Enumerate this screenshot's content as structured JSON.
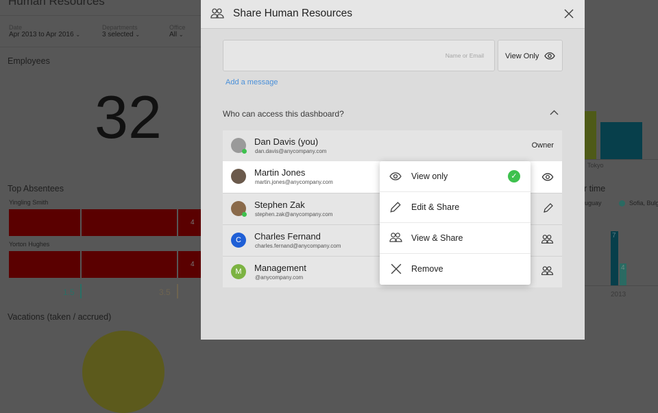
{
  "dashboard": {
    "title": "Human Resources",
    "filters": [
      {
        "label": "Date",
        "value": "Apr 2013 to Apr 2016"
      },
      {
        "label": "Departments",
        "value": "3 selected"
      },
      {
        "label": "Office",
        "value": "All"
      }
    ],
    "employees": {
      "title": "Employees",
      "value": "32"
    },
    "absentees": {
      "title": "Top Absentees",
      "rows": [
        {
          "name": "Yingling Smith",
          "value": "4"
        },
        {
          "name": "Yorton Hughes",
          "value": "4"
        }
      ],
      "axis": [
        "1.5",
        "3.5"
      ]
    },
    "vacations": {
      "title": "Vacations (taken / accrued)"
    },
    "right": {
      "category": "Tokyo",
      "title_fragment": "r time",
      "legend": [
        "uguay",
        "Sofia, Bulg"
      ],
      "bar_labels": [
        "7",
        "4"
      ],
      "year": "2013"
    }
  },
  "modal": {
    "title": "Share Human Resources",
    "input_placeholder": "Name or Email",
    "permission_button": "View Only",
    "add_message": "Add a message",
    "section_title": "Who can access this dashboard?",
    "people": [
      {
        "name": "Dan Davis (you)",
        "email": "dan.davis@anycompany.com",
        "role": "Owner"
      },
      {
        "name": "Martin Jones",
        "email": "martin.jones@anycompany.com"
      },
      {
        "name": "Stephen Zak",
        "email": "stephen.zak@anycompany.com"
      },
      {
        "name": "Charles Fernand",
        "email": "charles.fernand@anycompany.com",
        "initial": "C"
      },
      {
        "name": "Management",
        "email": "@anycompany.com",
        "initial": "M"
      }
    ],
    "menu": [
      "View only",
      "Edit & Share",
      "View & Share",
      "Remove"
    ]
  },
  "colors": {
    "accent": "#4a90d9",
    "check": "#3ec14e",
    "blue_avatar": "#1f5fd6",
    "green_avatar": "#7cb342"
  }
}
